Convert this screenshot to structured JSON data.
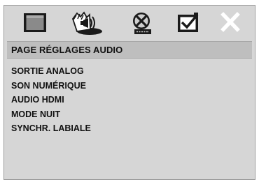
{
  "tabs": [
    {
      "icon": "display-icon",
      "label": ""
    },
    {
      "icon": "speaker-icon",
      "label": ""
    },
    {
      "icon": "disc-icon",
      "label": ""
    },
    {
      "icon": "preferences-icon",
      "label": ""
    },
    {
      "icon": "close-icon",
      "label": ""
    }
  ],
  "active_tab": "speaker-icon",
  "page": {
    "title": "PAGE RÉGLAGES AUDIO"
  },
  "menu": {
    "items": [
      {
        "label": "SORTIE ANALOG"
      },
      {
        "label": "SON NUMÉRIQUE"
      },
      {
        "label": "AUDIO HDMI"
      },
      {
        "label": "MODE NUIT"
      },
      {
        "label": "SYNCHR. LABIALE"
      }
    ]
  },
  "colors": {
    "background": "#d6d6d6",
    "header": "#bebebe",
    "icon": "#111111"
  }
}
